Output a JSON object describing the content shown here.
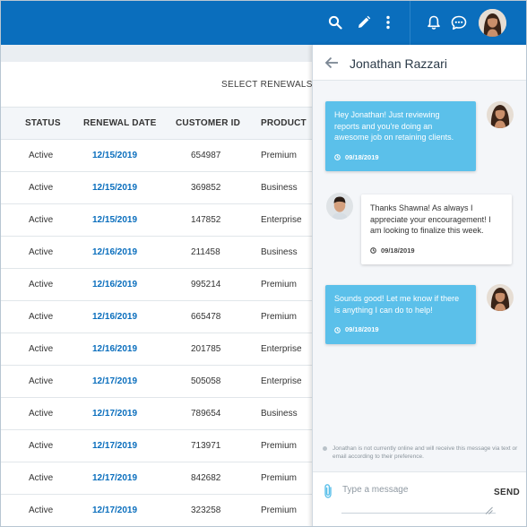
{
  "topbar": {
    "icons": [
      "search-icon",
      "pencil-icon",
      "more-vert-icon",
      "bell-icon",
      "chat-icon"
    ],
    "bg_color": "#0a6ebd"
  },
  "table": {
    "subheading": "SELECT RENEWALS D",
    "columns": [
      "STATUS",
      "RENEWAL DATE",
      "CUSTOMER ID",
      "PRODUCT"
    ],
    "rows": [
      {
        "status": "Active",
        "date": "12/15/2019",
        "id": "654987",
        "product": "Premium"
      },
      {
        "status": "Active",
        "date": "12/15/2019",
        "id": "369852",
        "product": "Business"
      },
      {
        "status": "Active",
        "date": "12/15/2019",
        "id": "147852",
        "product": "Enterprise"
      },
      {
        "status": "Active",
        "date": "12/16/2019",
        "id": "211458",
        "product": "Business"
      },
      {
        "status": "Active",
        "date": "12/16/2019",
        "id": "995214",
        "product": "Premium"
      },
      {
        "status": "Active",
        "date": "12/16/2019",
        "id": "665478",
        "product": "Premium"
      },
      {
        "status": "Active",
        "date": "12/16/2019",
        "id": "201785",
        "product": "Enterprise"
      },
      {
        "status": "Active",
        "date": "12/17/2019",
        "id": "505058",
        "product": "Enterprise"
      },
      {
        "status": "Active",
        "date": "12/17/2019",
        "id": "789654",
        "product": "Business"
      },
      {
        "status": "Active",
        "date": "12/17/2019",
        "id": "713971",
        "product": "Premium"
      },
      {
        "status": "Active",
        "date": "12/17/2019",
        "id": "842682",
        "product": "Premium"
      },
      {
        "status": "Active",
        "date": "12/17/2019",
        "id": "323258",
        "product": "Premium"
      }
    ]
  },
  "chat": {
    "contact_name": "Jonathan Razzari",
    "messages": [
      {
        "direction": "out",
        "text": "Hey Jonathan! Just reviewing reports and you're doing an awesome job on retaining clients.",
        "time": "09/18/2019"
      },
      {
        "direction": "in",
        "text": "Thanks Shawna! As always I appreciate your encouragement! I am looking to finalize this week.",
        "time": "09/18/2019"
      },
      {
        "direction": "out",
        "text": "Sounds good! Let me know if there is anything I can do to help!",
        "time": "09/18/2019"
      }
    ],
    "notice": "Jonathan is not currently online and will receive this message via text or email according to their preference.",
    "input_placeholder": "Type a message",
    "send_label": "SEND",
    "bubble_color": "#5bc0ea"
  }
}
